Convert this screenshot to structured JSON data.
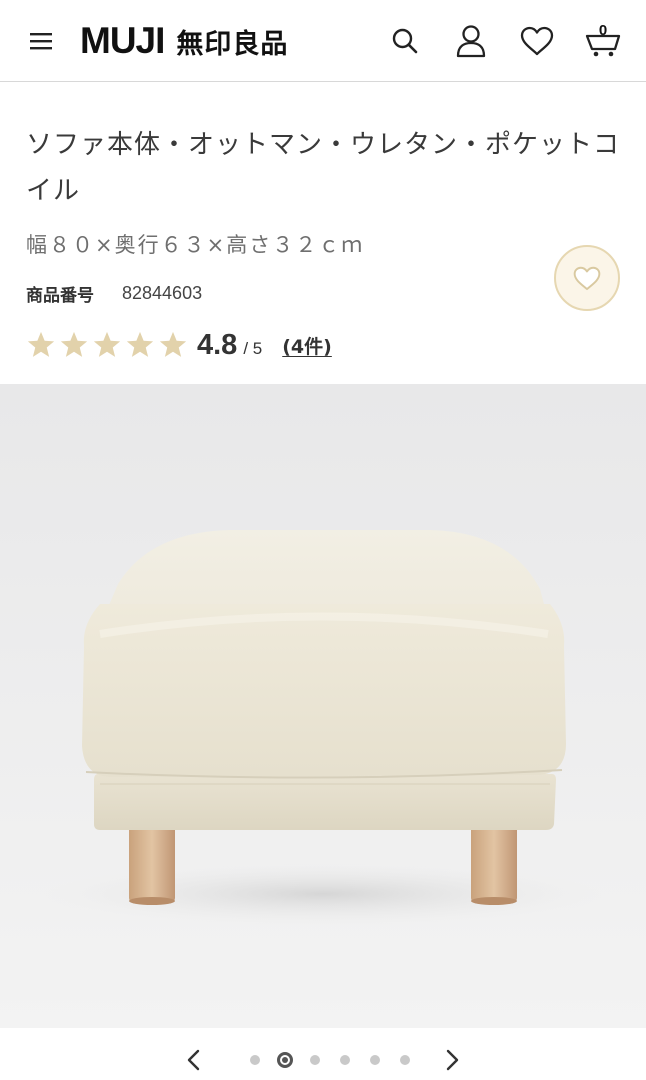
{
  "header": {
    "logo_en": "MUJI",
    "logo_ja": "無印良品",
    "cart_count": "0",
    "icons": [
      "menu-icon",
      "search-icon",
      "account-icon",
      "heart-icon",
      "cart-icon"
    ]
  },
  "product": {
    "title": "ソファ本体・オットマン・ウレタン・ポケットコイル",
    "size": "幅８０×奥行６３×高さ３２ｃｍ",
    "code_label": "商品番号",
    "code_value": "82844603",
    "rating_value": "4.8",
    "rating_max": "/ 5",
    "stars": 5,
    "review_link": "(4件)"
  },
  "carousel": {
    "total": 6,
    "active_index": 1
  },
  "colors": {
    "star": "#e2d2ab",
    "fav_bg": "#fbf5e8",
    "fav_border": "#e6d7b1",
    "divider": "#d8d8d8"
  }
}
